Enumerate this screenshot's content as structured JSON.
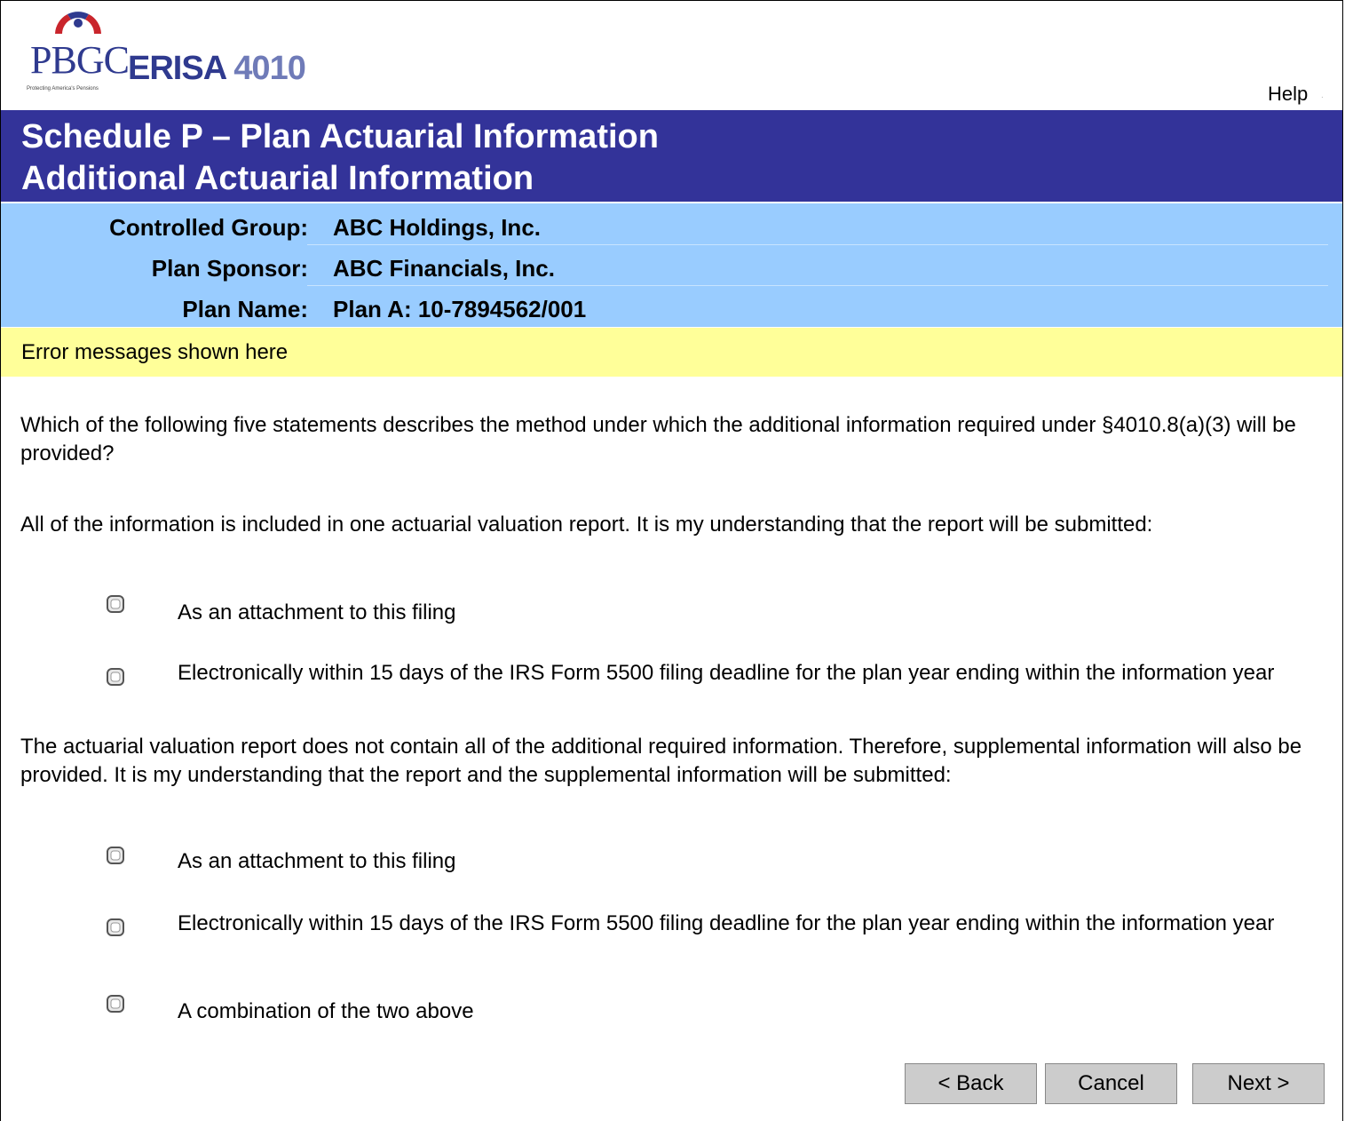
{
  "header": {
    "logo_pbgc": "PBGC",
    "logo_erisa": "ERISA",
    "logo_number": "4010",
    "logo_tagline": "Protecting America's Pensions",
    "help_label": "Help"
  },
  "title": {
    "line1": "Schedule P – Plan Actuarial Information",
    "line2": "Additional Actuarial Information"
  },
  "info": {
    "controlled_group_label": "Controlled Group:",
    "controlled_group_value": "ABC Holdings, Inc.",
    "plan_sponsor_label": "Plan Sponsor:",
    "plan_sponsor_value": "ABC Financials, Inc.",
    "plan_name_label": "Plan Name:",
    "plan_name_value": "Plan A: 10-7894562/001"
  },
  "error_message": "Error messages shown here",
  "question": "Which of the following five statements describes the method under which the additional information required under §4010.8(a)(3) will be provided?",
  "group1": {
    "intro": "All of the information is included in one actuarial valuation report.  It is my understanding that the report will be submitted:",
    "options": [
      "As an attachment to this filing",
      "Electronically within 15 days of the IRS Form 5500 filing deadline for the plan year ending within the information year"
    ]
  },
  "group2": {
    "intro": "The actuarial valuation report does not contain all of the additional required information. Therefore, supplemental information will also be provided.  It is my understanding that the report and the supplemental information will be submitted:",
    "options": [
      "As an attachment to this filing",
      "Electronically within 15 days of the IRS Form 5500 filing deadline for the plan year ending within the information year",
      "A combination of the two above"
    ]
  },
  "buttons": {
    "back": "< Back",
    "cancel": "Cancel",
    "next": "Next >"
  },
  "colors": {
    "title_bar": "#333399",
    "info_band": "#99ccff",
    "error_bar": "#ffff99",
    "button": "#cccccc"
  }
}
